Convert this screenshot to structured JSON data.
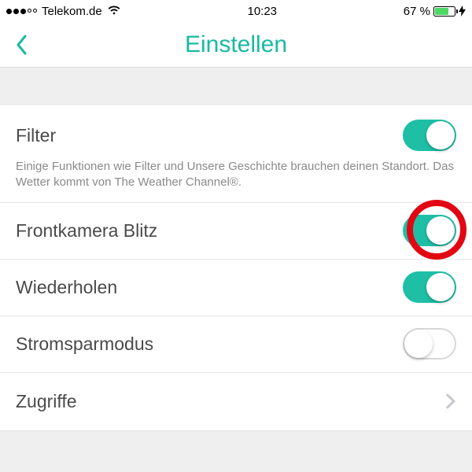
{
  "status": {
    "carrier": "Telekom.de",
    "time": "10:23",
    "battery_pct": "67 %",
    "battery_fill_pct": 67
  },
  "nav": {
    "title": "Einstellen"
  },
  "rows": {
    "filter": {
      "label": "Filter",
      "on": true
    },
    "hint": "Einige Funktionen wie Filter und Unsere Geschichte brauchen deinen Standort. Das Wetter kommt von The Weather Channel®.",
    "front_flash": {
      "label": "Frontkamera Blitz",
      "on": true
    },
    "replay": {
      "label": "Wiederholen",
      "on": true
    },
    "power_save": {
      "label": "Stromsparmodus",
      "on": false
    },
    "permissions": {
      "label": "Zugriffe"
    }
  },
  "annotation": {
    "highlight_target": "front_flash_toggle"
  }
}
